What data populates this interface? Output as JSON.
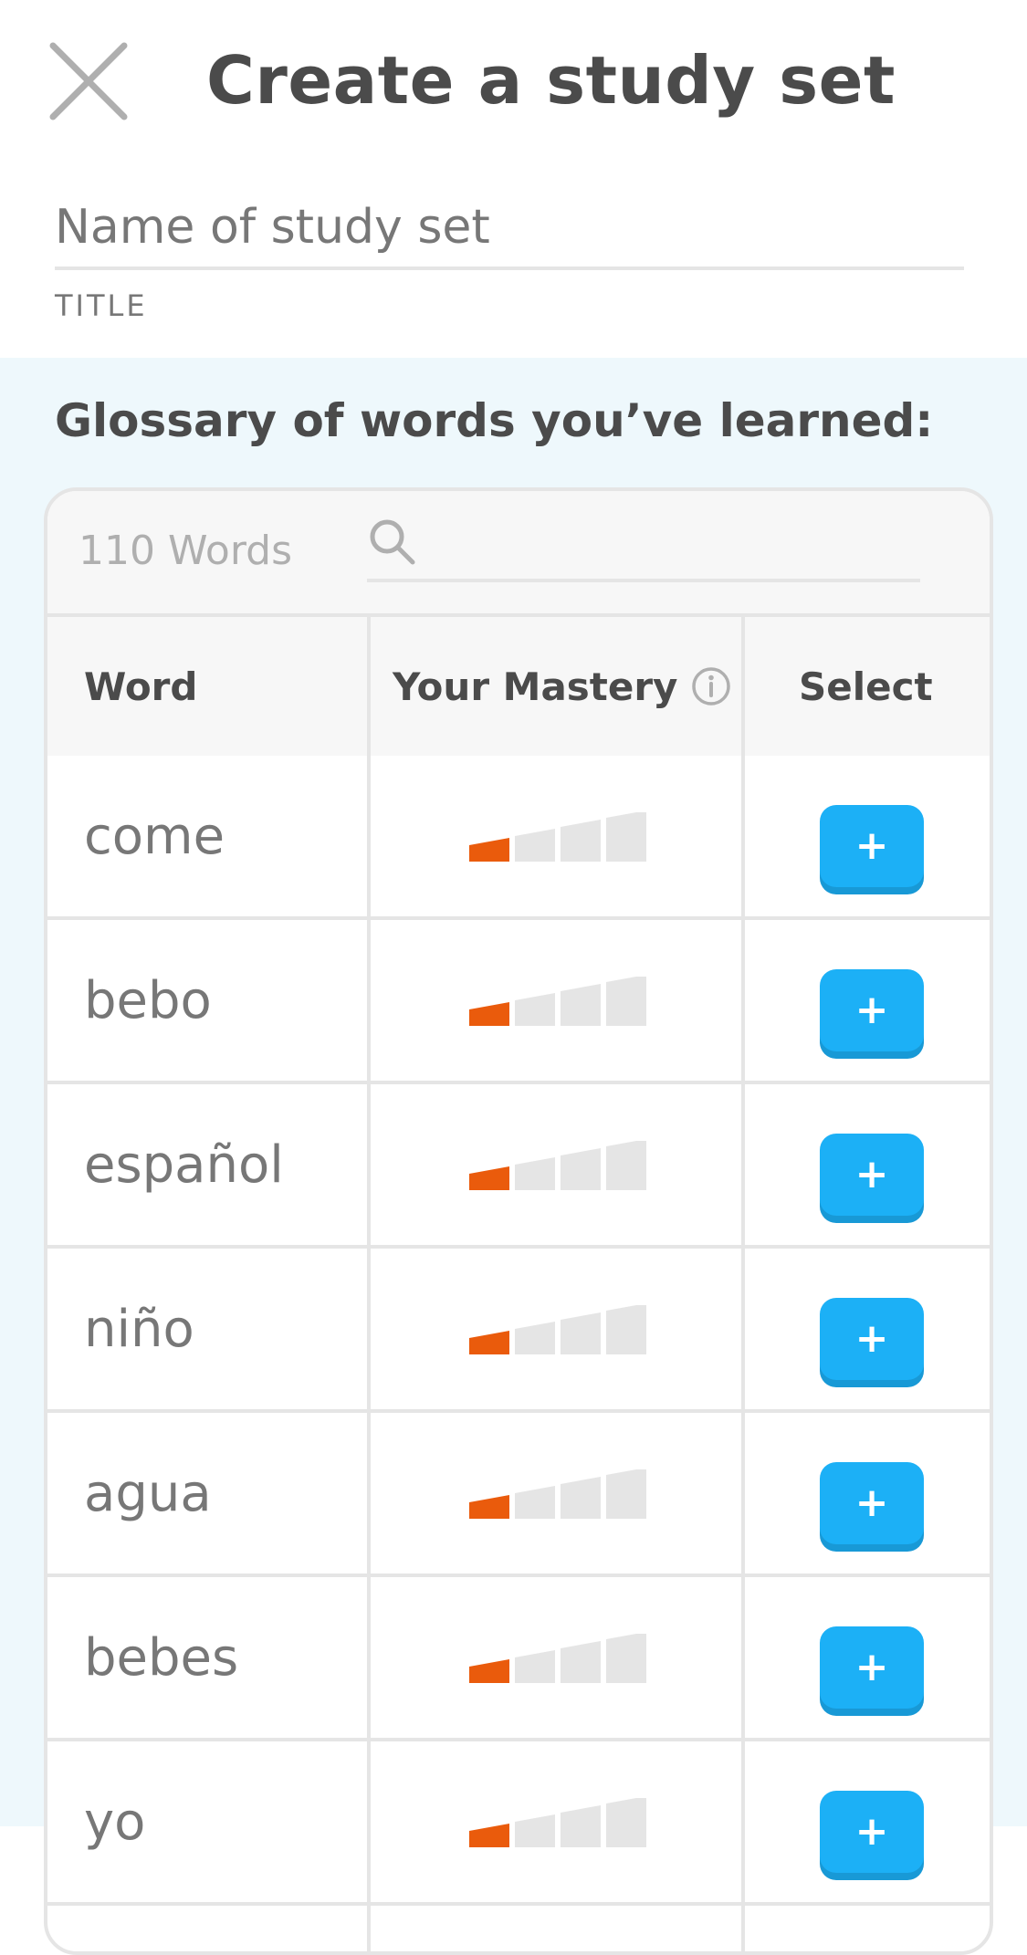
{
  "header": {
    "title": "Create a study set",
    "close_icon": "close-icon",
    "name_input": {
      "value": "",
      "placeholder": "Name of study set"
    },
    "name_label": "TITLE"
  },
  "glossary": {
    "heading": "Glossary of words you’ve learned:",
    "word_count": "110 Words",
    "search": {
      "value": "",
      "placeholder": "",
      "icon": "search-icon"
    },
    "columns": {
      "word": "Word",
      "mastery": "Your Mastery",
      "mastery_info_icon": "info-icon",
      "select": "Select"
    },
    "rows": [
      {
        "word": "come",
        "mastery_level": 1,
        "mastery_max": 4,
        "select_label": "+"
      },
      {
        "word": "bebo",
        "mastery_level": 1,
        "mastery_max": 4,
        "select_label": "+"
      },
      {
        "word": "español",
        "mastery_level": 1,
        "mastery_max": 4,
        "select_label": "+"
      },
      {
        "word": "niño",
        "mastery_level": 1,
        "mastery_max": 4,
        "select_label": "+"
      },
      {
        "word": "agua",
        "mastery_level": 1,
        "mastery_max": 4,
        "select_label": "+"
      },
      {
        "word": "bebes",
        "mastery_level": 1,
        "mastery_max": 4,
        "select_label": "+"
      },
      {
        "word": "yo",
        "mastery_level": 1,
        "mastery_max": 4,
        "select_label": "+"
      }
    ]
  },
  "colors": {
    "accent_blue": "#1cb0f6",
    "accent_blue_shadow": "#1899d6",
    "mastery_filled": "#ea5b0c",
    "mastery_empty": "#e5e5e5",
    "panel_background": "#eef8fc",
    "text_primary": "#4b4b4b",
    "text_secondary": "#777777"
  }
}
